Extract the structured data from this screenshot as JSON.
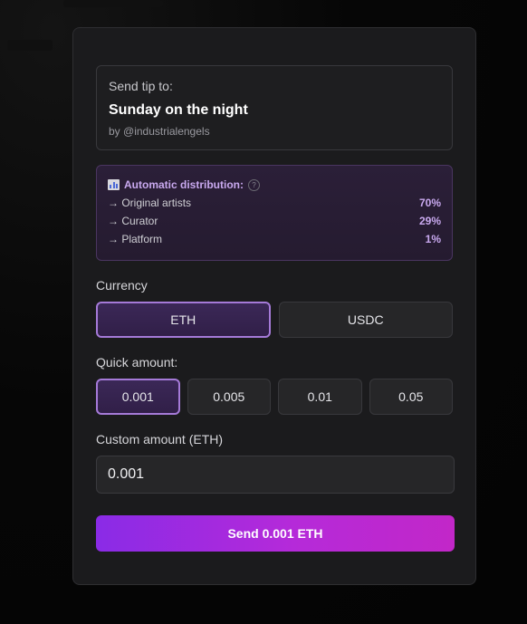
{
  "recipient": {
    "label": "Send tip to:",
    "title": "Sunday on the night",
    "by": "by @industrialengels"
  },
  "distribution": {
    "icon": "bar-chart-icon",
    "heading": "Automatic distribution:",
    "help_icon": "question-mark-icon",
    "help_glyph": "?",
    "rows": [
      {
        "label": "→ Original artists",
        "pct": "70%"
      },
      {
        "label": "→ Curator",
        "pct": "29%"
      },
      {
        "label": "→ Platform",
        "pct": "1%"
      }
    ],
    "accent_color": "#c9a9ef"
  },
  "currency": {
    "label": "Currency",
    "options": [
      "ETH",
      "USDC"
    ],
    "selected": "ETH"
  },
  "quick_amount": {
    "label": "Quick amount:",
    "options": [
      "0.001",
      "0.005",
      "0.01",
      "0.05"
    ],
    "selected": "0.001"
  },
  "custom_amount": {
    "label": "Custom amount (ETH)",
    "value": "0.001"
  },
  "send_button": {
    "label": "Send 0.001 ETH"
  },
  "colors": {
    "selection_border": "#a57ad8",
    "send_gradient_start": "#8a2be6",
    "send_gradient_end": "#c227c8"
  }
}
